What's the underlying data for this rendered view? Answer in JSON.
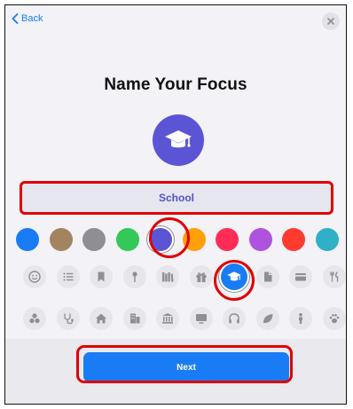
{
  "nav": {
    "back_label": "Back"
  },
  "title": "Name Your Focus",
  "name_field": {
    "value": "School"
  },
  "icon_color": "#5b55d6",
  "colors": [
    {
      "name": "blue",
      "hex": "#1a7cf5"
    },
    {
      "name": "tan",
      "hex": "#a28560"
    },
    {
      "name": "gray",
      "hex": "#8e8e93"
    },
    {
      "name": "green",
      "hex": "#34c759"
    },
    {
      "name": "indigo",
      "hex": "#5b55d6",
      "selected": true
    },
    {
      "name": "orange",
      "hex": "#ff9f0a"
    },
    {
      "name": "pink",
      "hex": "#ff2d55"
    },
    {
      "name": "purple",
      "hex": "#af52de"
    },
    {
      "name": "red",
      "hex": "#ff3b30"
    },
    {
      "name": "teal",
      "hex": "#30b0c7"
    }
  ],
  "symbols_row1": [
    "smiley-icon",
    "list-icon",
    "bookmark-icon",
    "pin-icon",
    "books-icon",
    "gift-icon",
    "graduation-cap-icon",
    "document-icon",
    "credit-card-icon",
    "fork-knife-icon"
  ],
  "symbols_row2": [
    "pills-icon",
    "stethoscope-icon",
    "house-icon",
    "building-icon",
    "bank-icon",
    "monitor-icon",
    "headphones-icon",
    "leaf-icon",
    "person-icon",
    "paw-icon"
  ],
  "selected_symbol": "graduation-cap-icon",
  "next_button": {
    "label": "Next"
  }
}
